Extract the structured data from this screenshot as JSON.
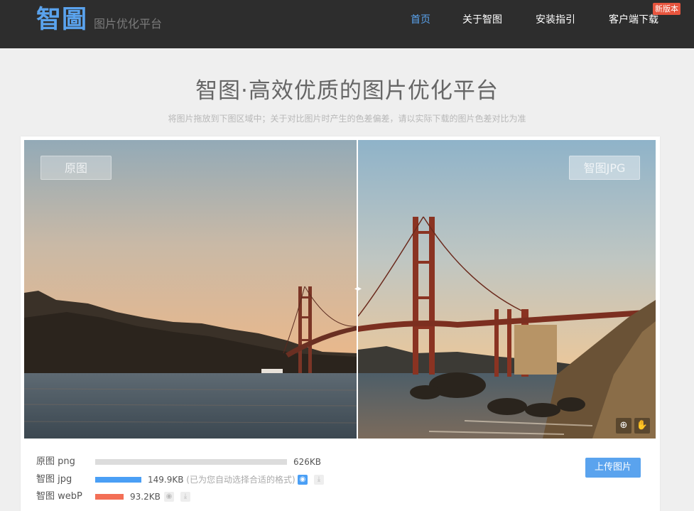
{
  "header": {
    "logo": "智圖",
    "logo_subtitle": "图片优化平台",
    "nav": [
      {
        "label": "首页",
        "active": true
      },
      {
        "label": "关于智图",
        "active": false
      },
      {
        "label": "安装指引",
        "active": false
      },
      {
        "label": "客户端下载",
        "active": false
      }
    ],
    "new_badge": "新版本"
  },
  "hero": {
    "title": "智图·高效优质的图片优化平台",
    "subtitle": "将图片拖放到下图区域中；关于对比图片时产生的色差偏差，请以实际下载的图片色差对比为准"
  },
  "compare": {
    "left_tag": "原图",
    "right_tag": "智图JPG",
    "handle_glyph": "◂▸",
    "zoom_icon": "magnifier-plus-icon",
    "drag_icon": "hand-icon"
  },
  "results": [
    {
      "label": "原图 png",
      "size": "626KB",
      "note": "",
      "bar_fraction": 1.0,
      "bar_color": "#dcdcdc"
    },
    {
      "label": "智图 jpg",
      "size": "149.9KB",
      "note": "(已为您自动选择合适的格式)",
      "bar_fraction": 0.239,
      "bar_color": "#4a9ff5"
    },
    {
      "label": "智图 webP",
      "size": "93.2KB",
      "note": "",
      "bar_fraction": 0.149,
      "bar_color": "#f36f56"
    }
  ],
  "upload_label": "上传图片",
  "colors": {
    "accent": "#5aa3ee",
    "header_bg": "#2d2d2d",
    "badge": "#e8553e"
  }
}
